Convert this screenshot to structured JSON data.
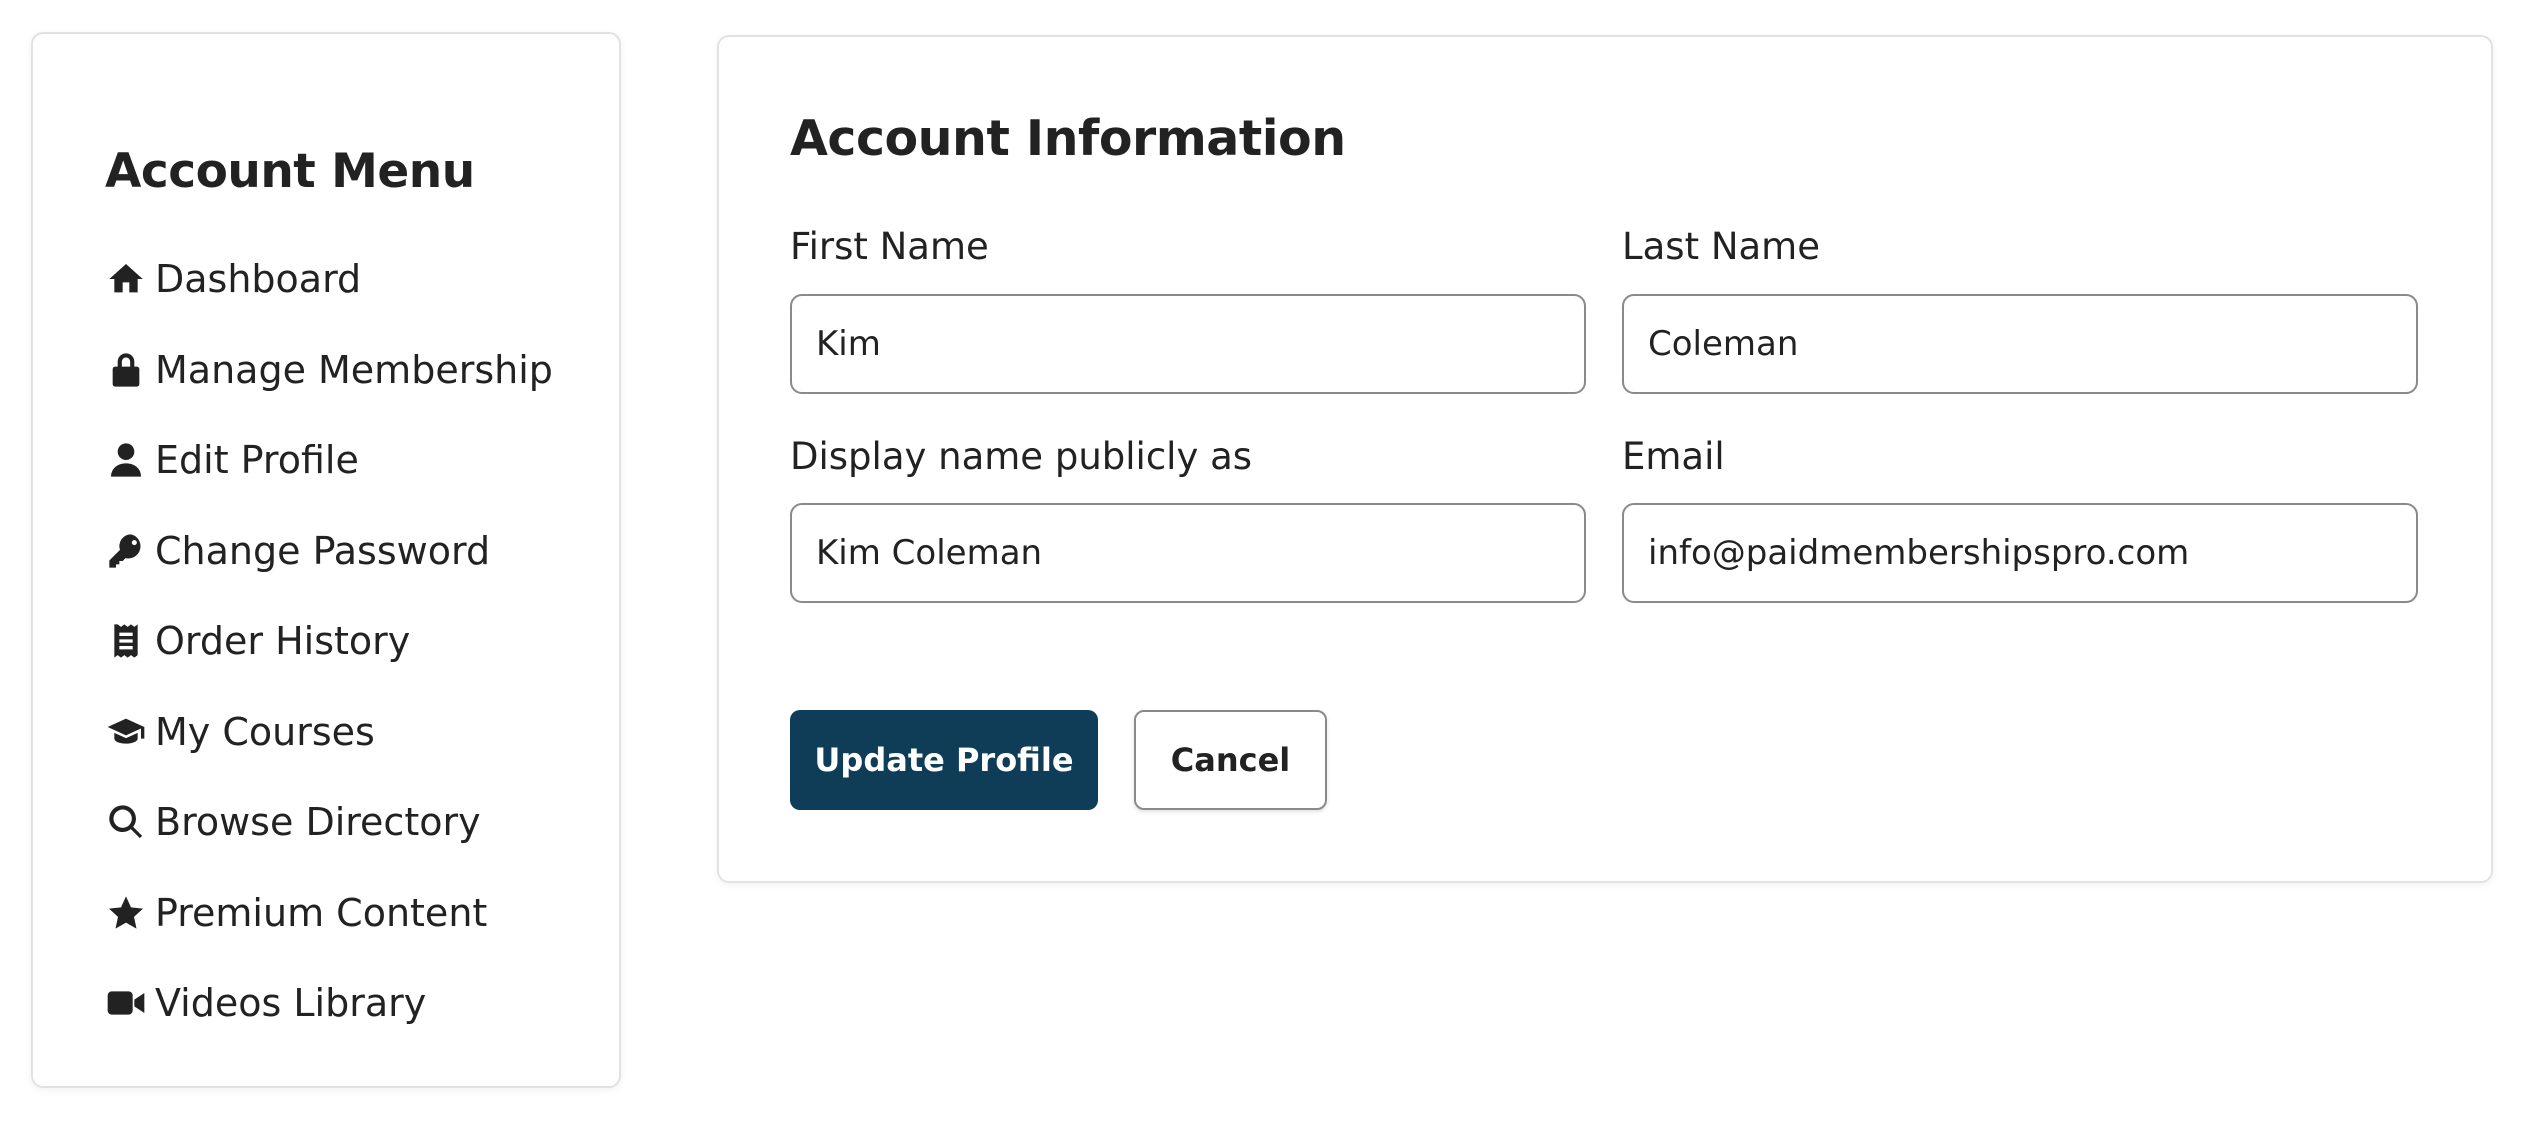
{
  "sidebar": {
    "title": "Account Menu",
    "items": [
      {
        "label": "Dashboard",
        "icon": "home-icon"
      },
      {
        "label": "Manage Membership",
        "icon": "lock-icon"
      },
      {
        "label": "Edit Profile",
        "icon": "user-icon"
      },
      {
        "label": "Change Password",
        "icon": "key-icon"
      },
      {
        "label": "Order History",
        "icon": "receipt-icon"
      },
      {
        "label": "My Courses",
        "icon": "graduation-cap-icon"
      },
      {
        "label": "Browse Directory",
        "icon": "search-icon"
      },
      {
        "label": "Premium Content",
        "icon": "star-icon"
      },
      {
        "label": "Videos Library",
        "icon": "video-icon"
      }
    ]
  },
  "main": {
    "title": "Account Information",
    "fields": {
      "first_name": {
        "label": "First Name",
        "value": "Kim"
      },
      "last_name": {
        "label": "Last Name",
        "value": "Coleman"
      },
      "display_name": {
        "label": "Display name publicly as",
        "value": "Kim Coleman"
      },
      "email": {
        "label": "Email",
        "value": "info@paidmembershipspro.com"
      }
    },
    "buttons": {
      "update": "Update Profile",
      "cancel": "Cancel"
    }
  },
  "colors": {
    "primary_button": "#0f3d57",
    "text": "#222222",
    "border": "#8a8a8a"
  }
}
